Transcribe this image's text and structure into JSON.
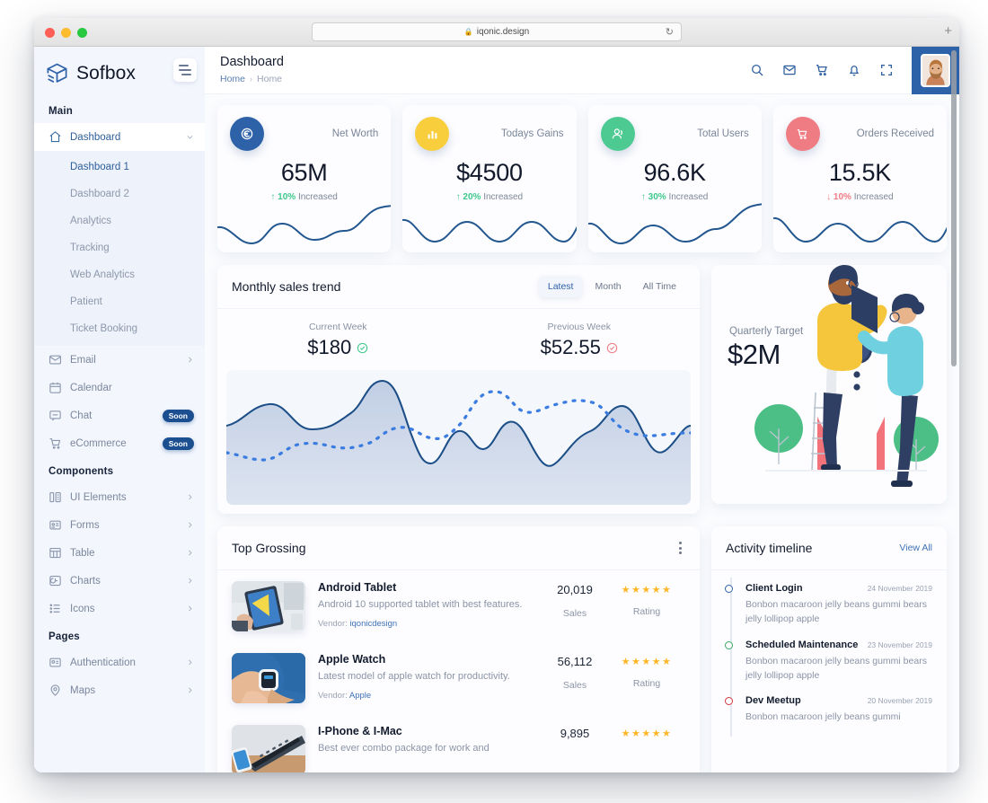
{
  "browser": {
    "url": "iqonic.design",
    "lock_icon": "lock-icon",
    "reload_icon": "reload-icon",
    "new_tab_label": "+"
  },
  "sidebar": {
    "brand": "Sofbox",
    "toggle_icon": "hamburger-toggle-icon",
    "groups": [
      {
        "title": "Main",
        "items": [
          {
            "label": "Dashboard",
            "icon": "home-icon",
            "active": true,
            "expandable": true,
            "children": [
              {
                "label": "Dashboard 1",
                "active": true
              },
              {
                "label": "Dashboard 2",
                "active": false
              },
              {
                "label": "Analytics",
                "active": false
              },
              {
                "label": "Tracking",
                "active": false
              },
              {
                "label": "Web Analytics",
                "active": false
              },
              {
                "label": "Patient",
                "active": false
              },
              {
                "label": "Ticket Booking",
                "active": false
              }
            ]
          },
          {
            "label": "Email",
            "icon": "mail-icon",
            "chevron": true
          },
          {
            "label": "Calendar",
            "icon": "calendar-icon"
          },
          {
            "label": "Chat",
            "icon": "chat-icon",
            "badge": "Soon"
          },
          {
            "label": "eCommerce",
            "icon": "cart-icon",
            "badge": "Soon"
          }
        ]
      },
      {
        "title": "Components",
        "items": [
          {
            "label": "UI Elements",
            "icon": "ui-elements-icon",
            "chevron": true
          },
          {
            "label": "Forms",
            "icon": "forms-icon",
            "chevron": true
          },
          {
            "label": "Table",
            "icon": "table-icon",
            "chevron": true
          },
          {
            "label": "Charts",
            "icon": "charts-icon",
            "chevron": true
          },
          {
            "label": "Icons",
            "icon": "icons-list-icon",
            "chevron": true
          }
        ]
      },
      {
        "title": "Pages",
        "items": [
          {
            "label": "Authentication",
            "icon": "authentication-icon",
            "chevron": true
          },
          {
            "label": "Maps",
            "icon": "map-pin-icon",
            "chevron": true
          }
        ]
      }
    ]
  },
  "topbar": {
    "title": "Dashboard",
    "breadcrumb": [
      "Home",
      "Home"
    ],
    "icons": [
      "search-icon",
      "mail-icon",
      "cart-icon",
      "bell-icon",
      "fullscreen-icon"
    ],
    "avatar": "user-avatar"
  },
  "stats": [
    {
      "label": "Net Worth",
      "value": "65M",
      "delta_pct": "10%",
      "delta_word": "Increased",
      "direction": "up",
      "icon": "coin-icon",
      "color": "#2e62a8"
    },
    {
      "label": "Todays Gains",
      "value": "$4500",
      "delta_pct": "20%",
      "delta_word": "Increased",
      "direction": "up",
      "icon": "bar-chart-icon",
      "color": "#f8ce3c"
    },
    {
      "label": "Total Users",
      "value": "96.6K",
      "delta_pct": "30%",
      "delta_word": "Increased",
      "direction": "up",
      "icon": "users-icon",
      "color": "#4cca92"
    },
    {
      "label": "Orders Received",
      "value": "15.5K",
      "delta_pct": "10%",
      "delta_word": "Increased",
      "direction": "down",
      "icon": "cart-icon",
      "color": "#ef7b83"
    }
  ],
  "sales": {
    "title": "Monthly sales trend",
    "tabs": [
      {
        "label": "Latest",
        "active": true
      },
      {
        "label": "Month",
        "active": false
      },
      {
        "label": "All Time",
        "active": false
      }
    ],
    "current_week_label": "Current Week",
    "current_week_value": "$180",
    "previous_week_label": "Previous Week",
    "previous_week_value": "$52.55"
  },
  "target": {
    "label": "Quarterly Target",
    "value": "$2M",
    "illustration": "rocket-team-illustration"
  },
  "grossing": {
    "title": "Top Grossing",
    "menu_icon": "kebab-menu-icon",
    "sales_label": "Sales",
    "rating_label": "Rating",
    "vendor_prefix": "Vendor:",
    "items": [
      {
        "name": "Android Tablet",
        "desc": "Android 10 supported tablet with best features.",
        "vendor": "iqonicdesign",
        "sales": "20,019",
        "stars": 5,
        "thumb": "tablet-photo"
      },
      {
        "name": "Apple Watch",
        "desc": "Latest model of apple watch for productivity.",
        "vendor": "Apple",
        "sales": "56,112",
        "stars": 5,
        "thumb": "watch-photo"
      },
      {
        "name": "I-Phone & I-Mac",
        "desc": "Best ever combo package for work and",
        "vendor": "",
        "sales": "9,895",
        "stars": 5,
        "thumb": "imac-photo"
      }
    ]
  },
  "timeline": {
    "title": "Activity timeline",
    "view_all": "View All",
    "items": [
      {
        "title": "Client Login",
        "date": "24 November 2019",
        "text": "Bonbon macaroon jelly beans gummi bears jelly lollipop apple",
        "color": "#2e62a8"
      },
      {
        "title": "Scheduled Maintenance",
        "date": "23 November 2019",
        "text": "Bonbon macaroon jelly beans gummi bears jelly lollipop apple",
        "color": "#3aa863"
      },
      {
        "title": "Dev Meetup",
        "date": "20 November 2019",
        "text": "Bonbon macaroon jelly beans gummi",
        "color": "#d0373f"
      }
    ]
  },
  "chart_data": {
    "type": "area",
    "title": "Monthly sales trend",
    "xlabel": "",
    "ylabel": "",
    "grid": false,
    "legend": [
      "Current Week",
      "Previous Week"
    ],
    "series": [
      {
        "name": "Current Week",
        "style": "solid-filled",
        "color": "#2e62a8",
        "values": [
          62,
          78,
          85,
          72,
          64,
          70,
          110,
          96,
          30,
          58,
          78,
          52,
          34,
          60,
          82,
          86,
          104,
          92,
          60,
          68,
          72
        ]
      },
      {
        "name": "Previous Week",
        "style": "dashed",
        "color": "#3a7ce0",
        "values": [
          34,
          40,
          44,
          48,
          52,
          48,
          44,
          50,
          62,
          70,
          62,
          50,
          58,
          96,
          108,
          94,
          92,
          96,
          100,
          84,
          62,
          62
        ]
      }
    ],
    "ylim": [
      0,
      130
    ]
  }
}
